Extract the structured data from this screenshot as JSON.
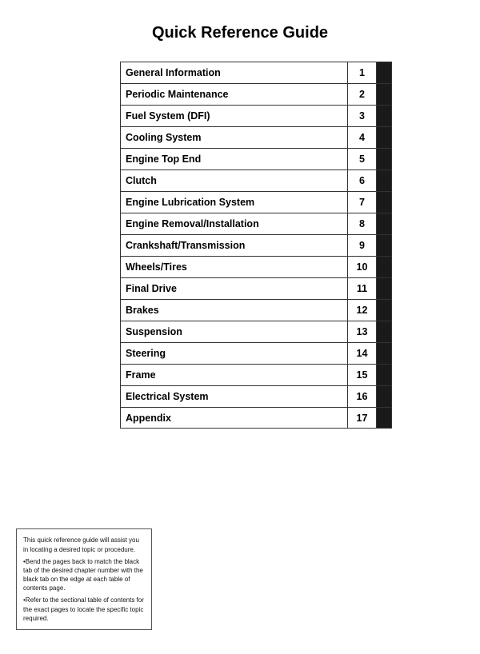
{
  "page": {
    "title": "Quick Reference Guide"
  },
  "toc": {
    "items": [
      {
        "label": "General Information",
        "number": "1"
      },
      {
        "label": "Periodic Maintenance",
        "number": "2"
      },
      {
        "label": "Fuel System (DFI)",
        "number": "3"
      },
      {
        "label": "Cooling System",
        "number": "4"
      },
      {
        "label": "Engine Top End",
        "number": "5"
      },
      {
        "label": "Clutch",
        "number": "6"
      },
      {
        "label": "Engine Lubrication System",
        "number": "7"
      },
      {
        "label": "Engine Removal/Installation",
        "number": "8"
      },
      {
        "label": "Crankshaft/Transmission",
        "number": "9"
      },
      {
        "label": "Wheels/Tires",
        "number": "10"
      },
      {
        "label": "Final Drive",
        "number": "11"
      },
      {
        "label": "Brakes",
        "number": "12"
      },
      {
        "label": "Suspension",
        "number": "13"
      },
      {
        "label": "Steering",
        "number": "14"
      },
      {
        "label": "Frame",
        "number": "15"
      },
      {
        "label": "Electrical System",
        "number": "16"
      },
      {
        "label": "Appendix",
        "number": "17"
      }
    ]
  },
  "note": {
    "line1": "This quick reference guide will assist you in locating a desired topic or procedure.",
    "line2": "•Bend the pages back to match the black tab of the desired chapter number with the black tab on the edge at each table of contents page.",
    "line3": "•Refer to the sectional table of contents for the exact pages to locate the specific topic required."
  }
}
